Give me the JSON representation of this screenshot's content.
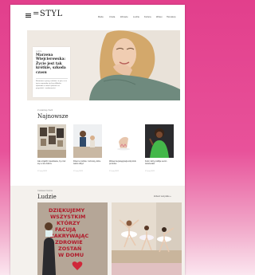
{
  "header": {
    "logo": "=STYL",
    "nav": [
      "Moda",
      "Uroda",
      "Zdrowie",
      "Ludzie",
      "Kultura",
      "Wideo",
      "Horoskop"
    ]
  },
  "hero": {
    "category": "Ludzie",
    "title": "Marzena Wiejcierowska: Życie jest tak krótkie, szkoda czasu",
    "lead": "Rozmowa o pracy, rodzinie i o tym, co w życiu naprawdę się liczy. Aktorka opowiada o swoich planach na przyszłość i codzienności."
  },
  "najnowsze": {
    "label": "Z ostatniej chwili",
    "title": "Najnowsze",
    "items": [
      {
        "title": "Jak urządzić mieszkanie, by czuć się w nim dobrze",
        "date": "12 maj 2021"
      },
      {
        "title": "Dzieci a rodzice: rozmowy, które warto odbyć",
        "date": "12 maj 2021"
      },
      {
        "title": "Wiosenna pielęgnacja stóp krok po kroku",
        "date": "12 maj 2021"
      },
      {
        "title": "Kolor, który podbije sezon wiosna-lato",
        "date": "12 maj 2021"
      }
    ]
  },
  "ludzie": {
    "label": "Ciekawe historie",
    "title": "Ludzie",
    "more": "Zobacz wszystkie »",
    "sign_lines": [
      "DZIĘKUJEMY",
      "WSZYSTKIM",
      "KTÓRZY",
      "FACUJĄ",
      "ZAKRYWAJĄC",
      "ZDROWIE",
      "ZOSTAŃ",
      "W DOMU"
    ]
  },
  "colors": {
    "frame": "#e23f8c",
    "accent": "#e23f8c",
    "page": "#ffffff",
    "band": "#f4f1ed"
  }
}
